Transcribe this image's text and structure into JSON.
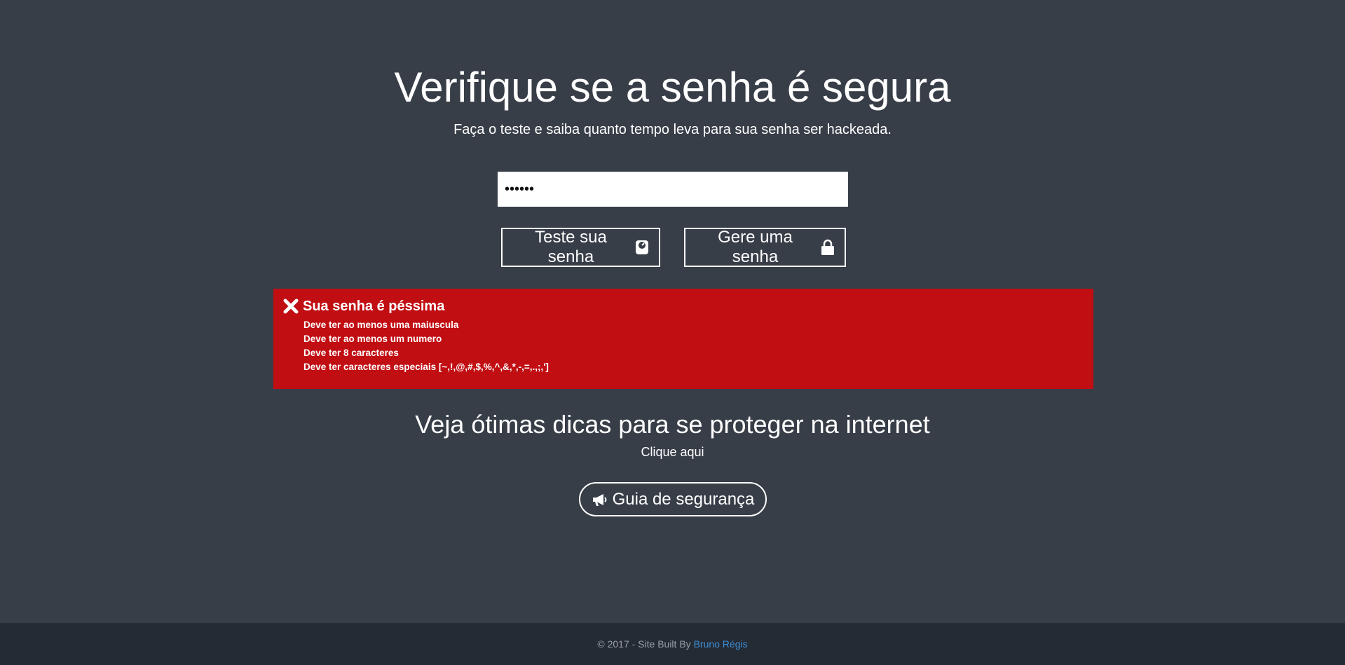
{
  "hero": {
    "title": "Verifique se a senha é segura",
    "subtitle": "Faça o teste e saiba quanto tempo leva para sua senha ser hackeada."
  },
  "password_input": {
    "value": "••••••"
  },
  "buttons": {
    "test_label": "Teste sua senha",
    "test_icon": "scale-icon",
    "generate_label": "Gere uma senha",
    "generate_icon": "lock-icon"
  },
  "alert": {
    "icon": "close-icon",
    "title": "Sua senha é péssima",
    "color": "#c10e13",
    "items": [
      "Deve ter ao menos uma maiuscula",
      "Deve ter ao menos um numero",
      "Deve ter 8 caracteres",
      "Deve ter caracteres especiais [~,!,@,#,$,%,^,&,*,-,=,.,;,']"
    ]
  },
  "tips": {
    "title": "Veja ótimas dicas para se proteger na internet",
    "subtitle": "Clique aqui",
    "button_label": "Guia de segurança",
    "button_icon": "megaphone-icon"
  },
  "footer": {
    "text": "© 2017 - Site Built By",
    "author": "Bruno Régis",
    "link_color": "#3d8fd6"
  },
  "colors": {
    "background": "#383e48",
    "footer_bg": "#252b35"
  }
}
